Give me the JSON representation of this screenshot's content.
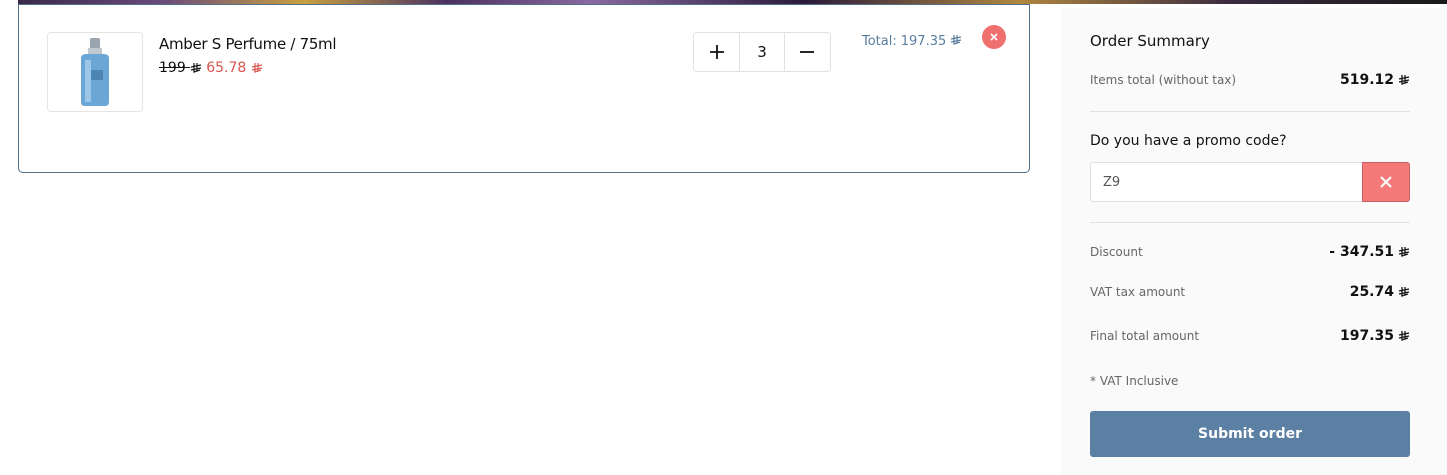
{
  "cart": {
    "items": [
      {
        "name": "Amber S Perfume / 75ml",
        "old_price": "199",
        "new_price": "65.78",
        "quantity": "3",
        "total_label": "Total:",
        "total_value": "197.35"
      }
    ]
  },
  "summary": {
    "title": "Order Summary",
    "items_total_label": "Items total (without tax)",
    "items_total_value": "519.12",
    "promo_question": "Do you have a promo code?",
    "promo_value": "Z9",
    "discount_label": "Discount",
    "discount_value": "- 347.51",
    "vat_label": "VAT tax amount",
    "vat_value": "25.74",
    "final_label": "Final total amount",
    "final_value": "197.35",
    "vat_note": "* VAT Inclusive",
    "submit_label": "Submit order"
  },
  "icons": {
    "currency": "saudi-riyal-icon",
    "plus": "plus-icon",
    "minus": "minus-icon",
    "remove": "close-icon"
  },
  "colors": {
    "accent": "#5b80a4",
    "danger": "#f07070",
    "sale_price": "#d9534f",
    "line_total": "#5a7e9e"
  }
}
